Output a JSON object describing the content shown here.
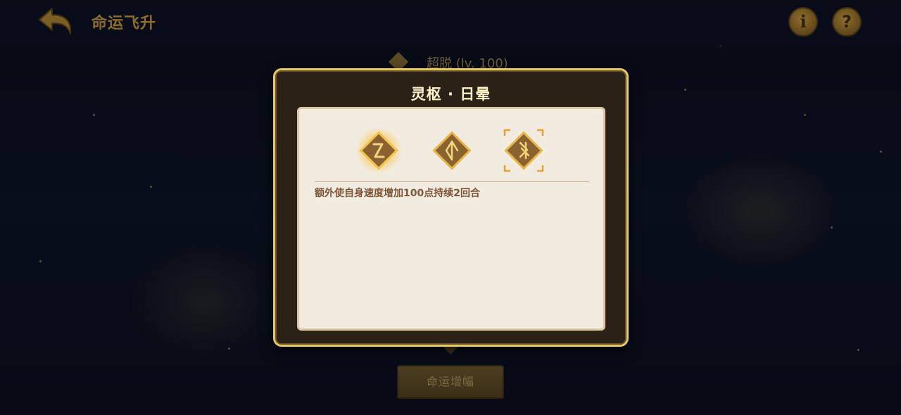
{
  "header": {
    "title": "命运飞升",
    "back_icon": "back-arrow-icon",
    "info_label": "i",
    "help_label": "?"
  },
  "background": {
    "level_text": "超脱 (lv. 100)",
    "amplify_button_label": "命运增幅"
  },
  "modal": {
    "title": "灵枢 · 日晕",
    "runes": [
      {
        "icon": "rune-z-icon",
        "state": "glowing"
      },
      {
        "icon": "rune-split-icon",
        "state": "normal"
      },
      {
        "icon": "rune-bolt-icon",
        "state": "selected"
      }
    ],
    "description": "额外使自身速度增加100点持续2回合"
  },
  "colors": {
    "modal_border": "#e6c766",
    "modal_bg": "#2b2117",
    "panel_bg": "#f2ebdf",
    "desc_text": "#7d5538",
    "rune_fill": "#8a6232",
    "accent_gold": "#f0b030"
  }
}
